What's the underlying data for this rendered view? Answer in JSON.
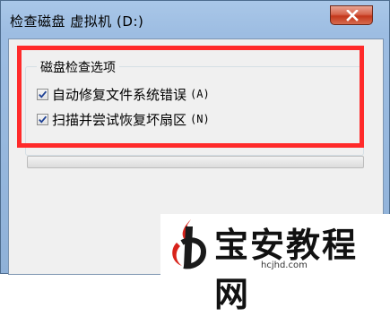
{
  "window": {
    "title": "检查磁盘 虚拟机 (D:)"
  },
  "group": {
    "title": "磁盘检查选项",
    "options": [
      {
        "label": "自动修复文件系统错误",
        "shortcut": "(A)",
        "checked": true
      },
      {
        "label": "扫描并尝试恢复坏扇区",
        "shortcut": "(N)",
        "checked": true
      }
    ]
  },
  "progress": {
    "value": 0
  },
  "watermark": {
    "text": "宝安教程网",
    "url": "hcjhd.com"
  },
  "colors": {
    "highlight": "#ff2a2a",
    "logo_red": "#d8231b"
  }
}
